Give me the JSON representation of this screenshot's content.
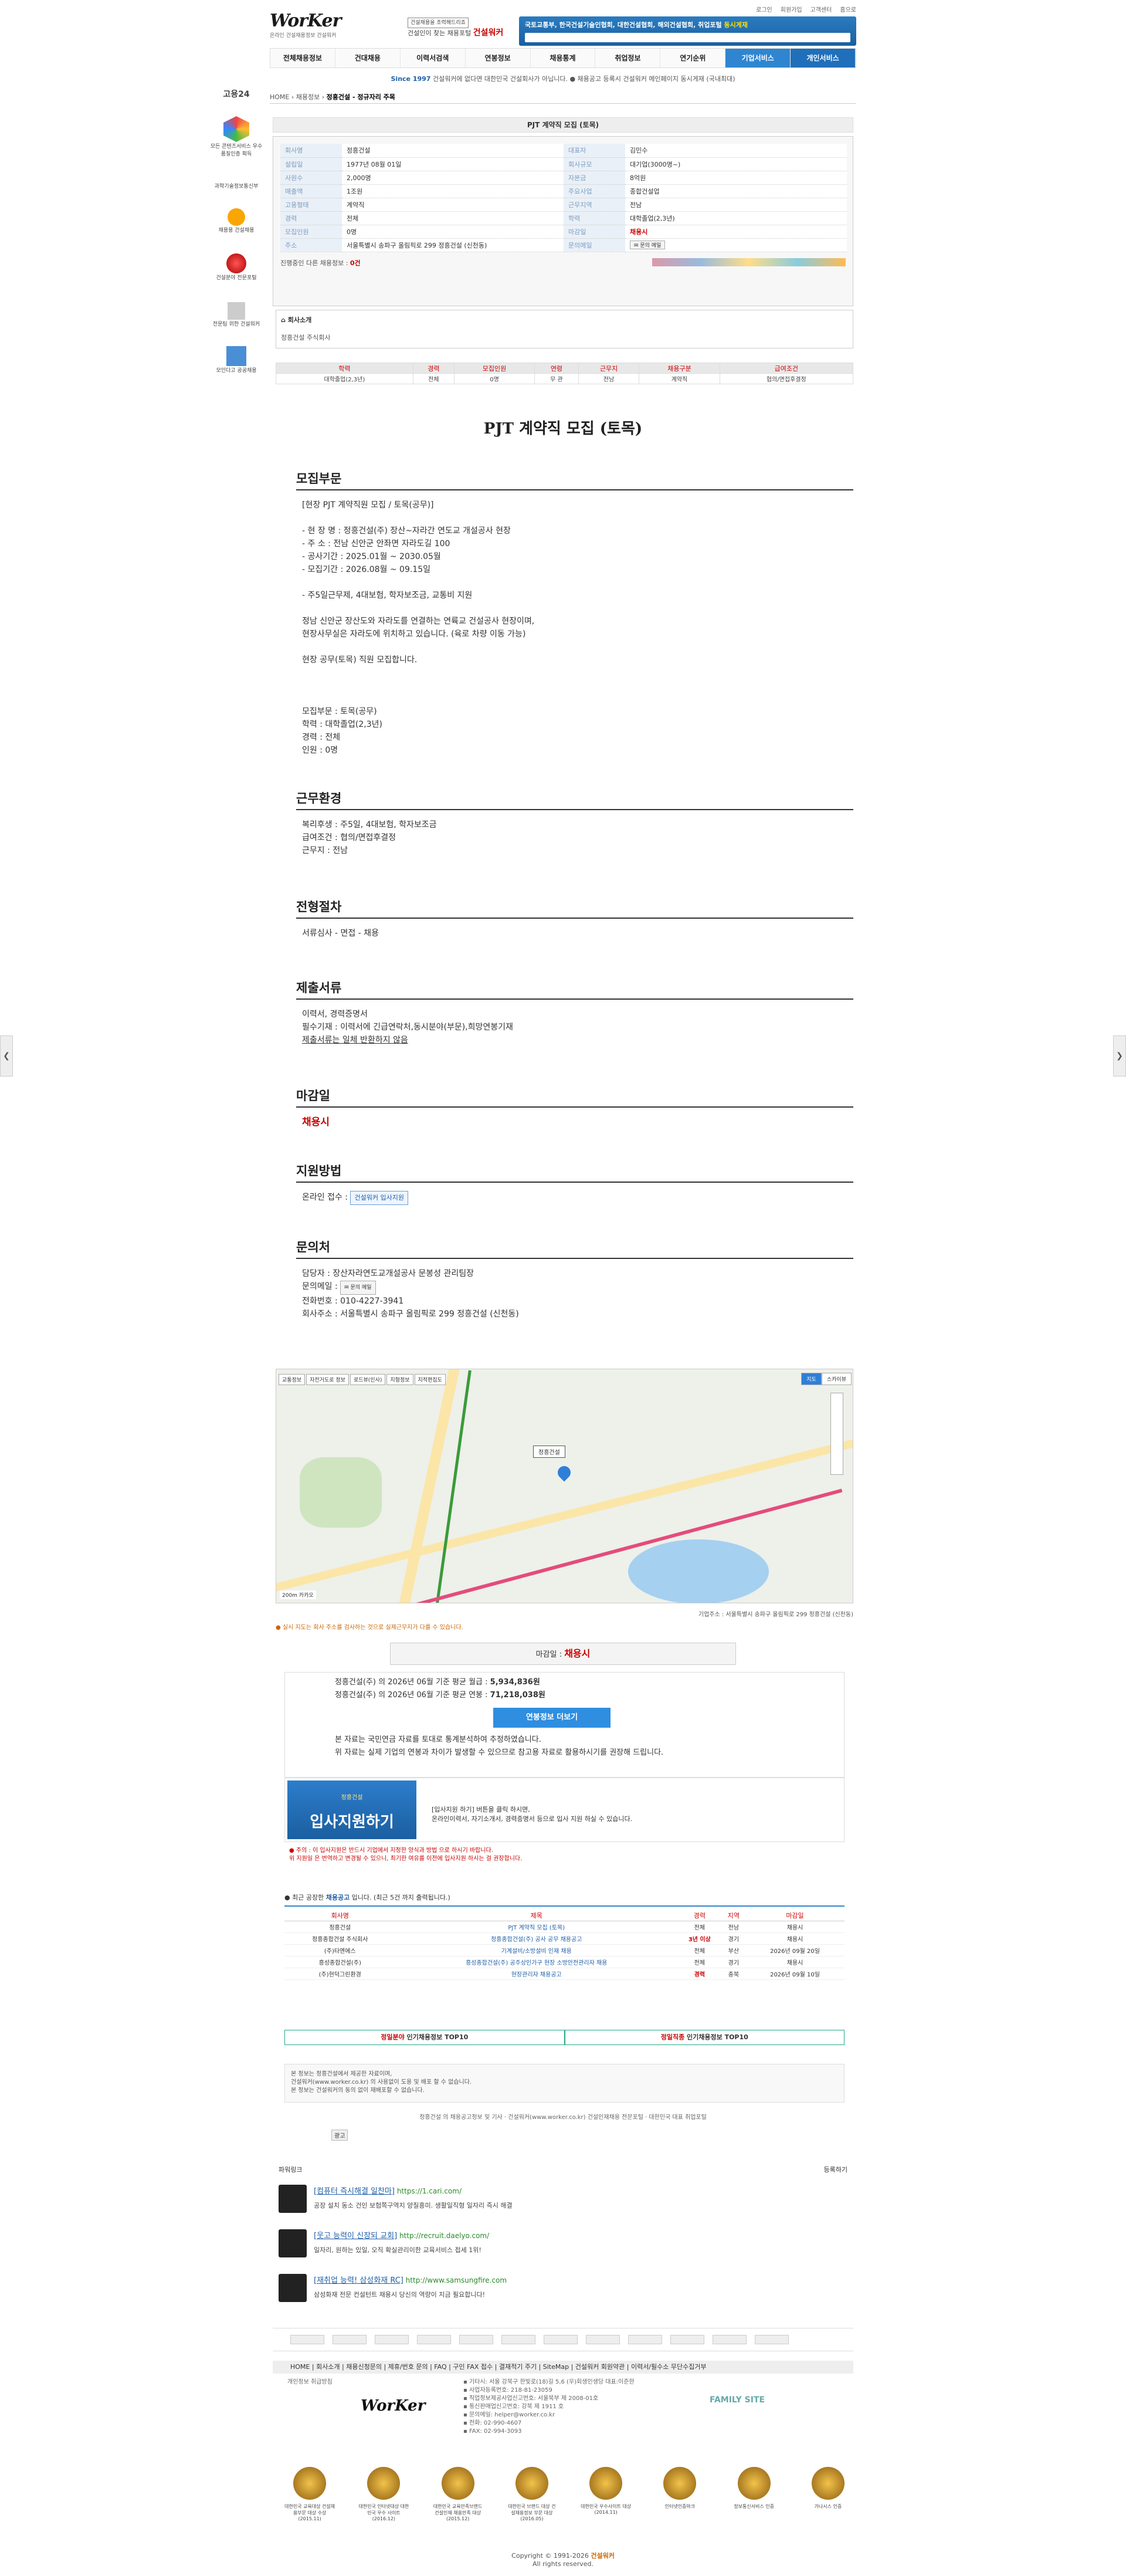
{
  "util": [
    "로그인",
    "회원가입",
    "고객센터",
    "홈으로"
  ],
  "logo": {
    "main": "WorKer",
    "sub": "온라인 건설채용정보 건설워커"
  },
  "midad": {
    "tag": "건설채용을 조력해드리죠",
    "line": "건설인이 찾는 채용포털",
    "brand": "건설워커"
  },
  "topbanner": {
    "text": "국토교통부, 한국건설기술인협회, 대한건설협회, 해외건설협회, 취업포털",
    "red": "동시게재"
  },
  "gnb": [
    "전체채용정보",
    "건대채용",
    "이력서검색",
    "연봉정보",
    "채용통계",
    "취업정보",
    "연기순위",
    "기업서비스",
    "개인서비스"
  ],
  "notice": {
    "since": "Since 1997",
    "text": "건설워커에 없다면 대한민국 건설회사가 아닙니다. ● 채용공고 등록시 건설워커 메인페이지 동시게재 (국내최대)"
  },
  "crumb": {
    "home": "HOME",
    "a": "채용정보",
    "b": "정흥건설 - 정규자리 주목"
  },
  "left": {
    "b1": "고용24",
    "b2": "모든 콘텐츠서비스 우수품질인증 획득",
    "b3": "과학기술정보통신부",
    "b4": "채용용 건설채용",
    "b5": "건설분야 전문포털",
    "b6": "전문팀 위한 건설워커",
    "b7": "모인다고 공공채용"
  },
  "job": {
    "title": "PJT 계약직 모집 (토목)",
    "rows": [
      [
        "회사명",
        "정흥건설",
        "대표자",
        "김민수"
      ],
      [
        "설립일",
        "1977년 08월 01일",
        "회사규모",
        "대기업(3000명~)"
      ],
      [
        "사원수",
        "2,000명",
        "자본금",
        "8억원"
      ],
      [
        "매출액",
        "1조원",
        "주요사업",
        "종합건설업"
      ],
      [
        "고용형태",
        "계약직",
        "근무지역",
        "전남"
      ],
      [
        "경력",
        "전체",
        "학력",
        "대학졸업(2,3년)"
      ],
      [
        "모집인원",
        "0명",
        "마감일",
        "채용시"
      ],
      [
        "주소",
        "서울특별시 송파구 올림픽로 299 정흥건설 (신천동)",
        "문의메일",
        "문의 메일"
      ]
    ],
    "foot": "진행중인 다른 채용정보 :",
    "foot_red": "0건"
  },
  "company": {
    "t": "회사소개",
    "n": "정흥건설 주식회사"
  },
  "sum": {
    "head": [
      "학력",
      "경력",
      "모집인원",
      "연령",
      "근무지",
      "채용구분",
      "급여조건"
    ],
    "row": [
      "대학졸업(2,3년)",
      "전체",
      "0명",
      "무 관",
      "전남",
      "계약직",
      "협의/면접후결정"
    ]
  },
  "main_title": "PJT 계약직 모집 (토목)",
  "sec1": {
    "h": "모집부문",
    "lines": [
      "[현장 PJT 계약직원 모집 / 토목(공무)]",
      "",
      "- 현 장 명 : 정흥건설(주) 장산~자라간 연도교 개설공사 현장",
      "- 주    소 : 전남 신안군 안좌면 자라도길 100",
      "- 공사기간 : 2025.01월 ~ 2030.05월",
      "- 모집기간 : 2026.08월 ~ 09.15일",
      "",
      "- 주5일근무제, 4대보험, 학자보조금, 교통비 지원",
      "",
      "정남 신안군 장산도와 자라도를 연결하는 연륙교 건설공사 현장이며,",
      "현장사무실은 자라도에 위치하고 있습니다. (육로 차량 이동 가능)",
      "",
      "현장 공무(토목) 직원 모집합니다.",
      "",
      "",
      "",
      "모집부문 : 토목(공무)",
      "학력 : 대학졸업(2,3년)",
      "경력 : 전체",
      "인원 : 0명"
    ]
  },
  "sec2": {
    "h": "근무환경",
    "lines": [
      "복리후생 : 주5일, 4대보험, 학자보조금",
      "급여조건 : 협의/면접후결정",
      "근무지 : 전남"
    ]
  },
  "sec3": {
    "h": "전형절차",
    "lines": [
      "서류심사 - 면접 - 채용"
    ]
  },
  "sec4": {
    "h": "제출서류",
    "lines": [
      "이력서, 경력증명서",
      "필수기재 : 이력서에 긴급연락처,동시분야(부문),희망연봉기재"
    ],
    "u": "제출서류는 일체 반환하지 않음"
  },
  "sec5": {
    "h": "마감일",
    "v": "채용시"
  },
  "sec6": {
    "h": "지원방법",
    "label": "온라인 접수 :",
    "btn": "건설워커 입사지원"
  },
  "sec7": {
    "h": "문의처",
    "l1": "담당자 : 장산자라연도교개설공사 문봉성 관리팀장",
    "l2": "문의메일 :",
    "mail": "문의 메일",
    "l3": "전화번호 : 010-4227-3941",
    "l4": "회사주소 : 서울특별시 송파구 올림픽로 299 정흥건설 (신천동)"
  },
  "map": {
    "tools": [
      "교통정보",
      "자전거도로 정보",
      "로드뷰(인사)",
      "지형정보",
      "지적편집도"
    ],
    "mt": [
      "지도",
      "스카이뷰"
    ],
    "label": "정흥건설",
    "scale": "200m  카카오"
  },
  "maddr": "기업주소 : 서울특별시 송파구 올림픽로 299 정흥건설 (신천동)",
  "mnote": "● 실시 지도는 회사 주소를 검사하는 것으로 실제근무지가 다를 수 있습니다.",
  "deadline": {
    "k": "마감일 :",
    "v": "채용시"
  },
  "salary": {
    "l1a": "정흥건설(주) 의 2026년 06월 기준 평균 월급 : ",
    "l1b": "5,934,836원",
    "l2a": "정흥건설(주) 의 2026년 06월 기준 평균 연봉 : ",
    "l2b": "71,218,038원",
    "btn": "연봉정보 더보기",
    "n1": "본 자료는 국민연금 자료를 토대로 통계분석하여 추정하였습니다.",
    "n2": "위 자료는 실제 기업의 연봉과 차이가 발생할 수 있으므로 참고용 자료로 활용하시기를 권장해 드립니다."
  },
  "apply": {
    "small": "정흥건설",
    "big": "입사지원하기",
    "t1": "[입사지원 하기] 버튼을 클릭 하시면,",
    "t2": "온라인이력서, 자기소개서, 경력증명서 등으로 입사 지원 하실 수 있습니다.",
    "w1": "● 주의 : 이 입사지원은 반드시 기업에서 지정한 양식과 방법 으로 하시기 바랍니다.",
    "w2": "  위 지원일 은 번역하고 변경될 수 있으니, 최기한 여유를 이전에 입사지원 하시는 걸 권장합니다."
  },
  "recent": {
    "h1": "최근 공장한 ",
    "h2": "채용공고",
    "h3": " 입니다. (최근 5건 까지 출력됩니다.)",
    "head": [
      "회사명",
      "제목",
      "경력",
      "지역",
      "마감일"
    ],
    "rows": [
      [
        "정흥건설",
        "PJT 계약직 모집 (토목)",
        "전체",
        "전남",
        "채용시"
      ],
      [
        "정흥종합건설 주식회사",
        "정흥종합건설(주) 공사 공무 채용공고",
        "3년 이상",
        "경기",
        "채용시"
      ],
      [
        "(주)타엔에스",
        "기계설비/소방설비 인재 채용",
        "전체",
        "부산",
        "2026년 09월 20일"
      ],
      [
        "흥성종합건설(주)",
        "흥성종합건설(주) 공주상인가구 현장 소방안전관리자 채용",
        "전체",
        "경기",
        "채용시"
      ],
      [
        "(주)현덕그린환경",
        "현장관리자 채용공고",
        "경력",
        "충북",
        "2026년 09월 10일"
      ]
    ]
  },
  "top10": {
    "a1": "정일분야",
    "a2": " 인기채용정보 TOP10",
    "b1": "정일직종",
    "b2": " 인기채용정보 TOP10"
  },
  "note": [
    "본 정보는 정흥건설에서 제공한 자료이며,",
    "건설워커(www.worker.co.kr) 의 사용없이 도용 및 배포 할 수 없습니다.",
    "본 정보는 건설워커의 동의 없이 재배포할 수 없습니다."
  ],
  "copy1": "정흥건설 의 채용공고정보 및 기사 · 건설워커(www.worker.co.kr) 건설인재채용 전문포털 · 대한민국 대표 취업포털",
  "adbtn": "광고",
  "ads": {
    "h": "파워링크",
    "reg": "등록하기",
    "list": [
      {
        "t": "[컴퓨터 즉시해결 일찬마]",
        "u": "https://1.cari.com/",
        "d": "공장 설치 동소 건인 보험쪽구역지 양질흥미. 생활일직형 일자리 즉시 해결"
      },
      {
        "t": "[웃고 능력이 신장되 교회]",
        "u": "http://recruit.daelyo.com/",
        "d": "일자리, 원하는 있일, 오직 확실관리이한 교육서비스 접세 1위!"
      },
      {
        "t": "[재취업 능력! 삼성화재 RC]",
        "u": "http://www.samsungfire.com",
        "d": "삼성화재 전문 컨설턴트 채용시 당신의 역량이 지금 필요합니다!"
      }
    ]
  },
  "fnav": "HOME | 회사소개 | 채용신청문의 | 제휴/번호 문의 | FAQ | 구인 FAX 접수 | 결재적기 주기 | SiteMap | 건설워커 회원약관 | 이력서/필수소 무단수집거부",
  "foot": {
    "left": "개인정보 취급방침",
    "logo": "WorKer",
    "info": [
      "▪ 기타시: 서울 강북구 한빛로(18)길 5,6 (우)회생인생당 대표:이준한",
      "▪ 사업자등록번호: 218-81-23059",
      "▪ 직업정보제공사업신고번호: 서울북부 제 2008-01호",
      "▪ 통신판매업신고번호: 강북 제 1911 호",
      "▪ 문의메일: helper@worker.co.kr",
      "▪ 전화: 02-990-4607",
      "▪ FAX: 02-994-3093"
    ],
    "family": "FAMILY SITE"
  },
  "medals": [
    "대한민국 교육대상 건설채용부문 대상 수상 (2015.11)",
    "대한민국 인터넷대상 대한민국 우수 사이트 (2016.12)",
    "대한민국 교육만족브랜드 건설인재 채용만족 대상 (2015.12)",
    "대한민국 브랜드 대상 건설채용정보 부문 대상 (2016.05)",
    "대한민국 우수사이트 대상 (2014.11)",
    "인터넷인증마크",
    "정보통신서비스 인증",
    "가나시스 인증"
  ],
  "copy": {
    "a": "Copyright © 1991-2026 ",
    "b": "건설워커",
    "c": "All rights reserved."
  }
}
